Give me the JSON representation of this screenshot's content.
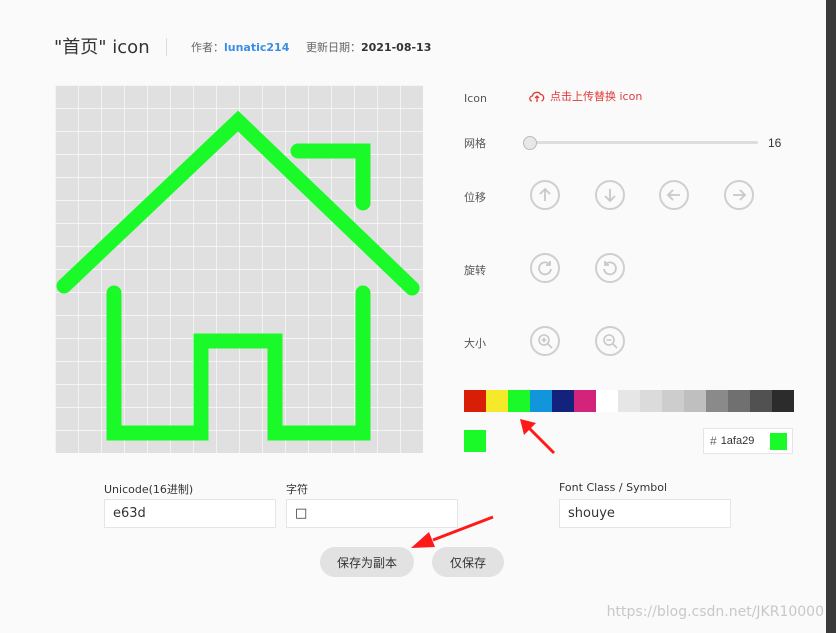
{
  "header": {
    "title": "\"首页\" icon",
    "author_label": "作者：",
    "author": "lunatic214",
    "date_label": "更新日期：",
    "date": "2021-08-13"
  },
  "controls": {
    "icon_label": "Icon",
    "upload_text": "点击上传替换 icon",
    "grid_label": "网格",
    "grid_value": "16",
    "grid_level": 0.0,
    "move_label": "位移",
    "rotate_label": "旋转",
    "size_label": "大小"
  },
  "palette": [
    "#d81e06",
    "#f4ea2a",
    "#1afa29",
    "#1296db",
    "#13227a",
    "#d4237a",
    "#ffffff",
    "#e6e6e6",
    "#dbdbdb",
    "#cdcdcd",
    "#bfbfbf",
    "#8a8a8a",
    "#707070",
    "#515151",
    "#2c2c2c"
  ],
  "current_color": "#1afa29",
  "hex": {
    "hash": "#",
    "value": "1afa29"
  },
  "fields": {
    "unicode_label": "Unicode(16进制)",
    "unicode_value": "e63d",
    "char_label": "字符",
    "char_value": "□",
    "font_class_label": "Font Class / Symbol",
    "font_class_value": "shouye"
  },
  "buttons": {
    "save_copy": "保存为副本",
    "save_only": "仅保存"
  },
  "watermark": "https://blog.csdn.net/JKR10000"
}
